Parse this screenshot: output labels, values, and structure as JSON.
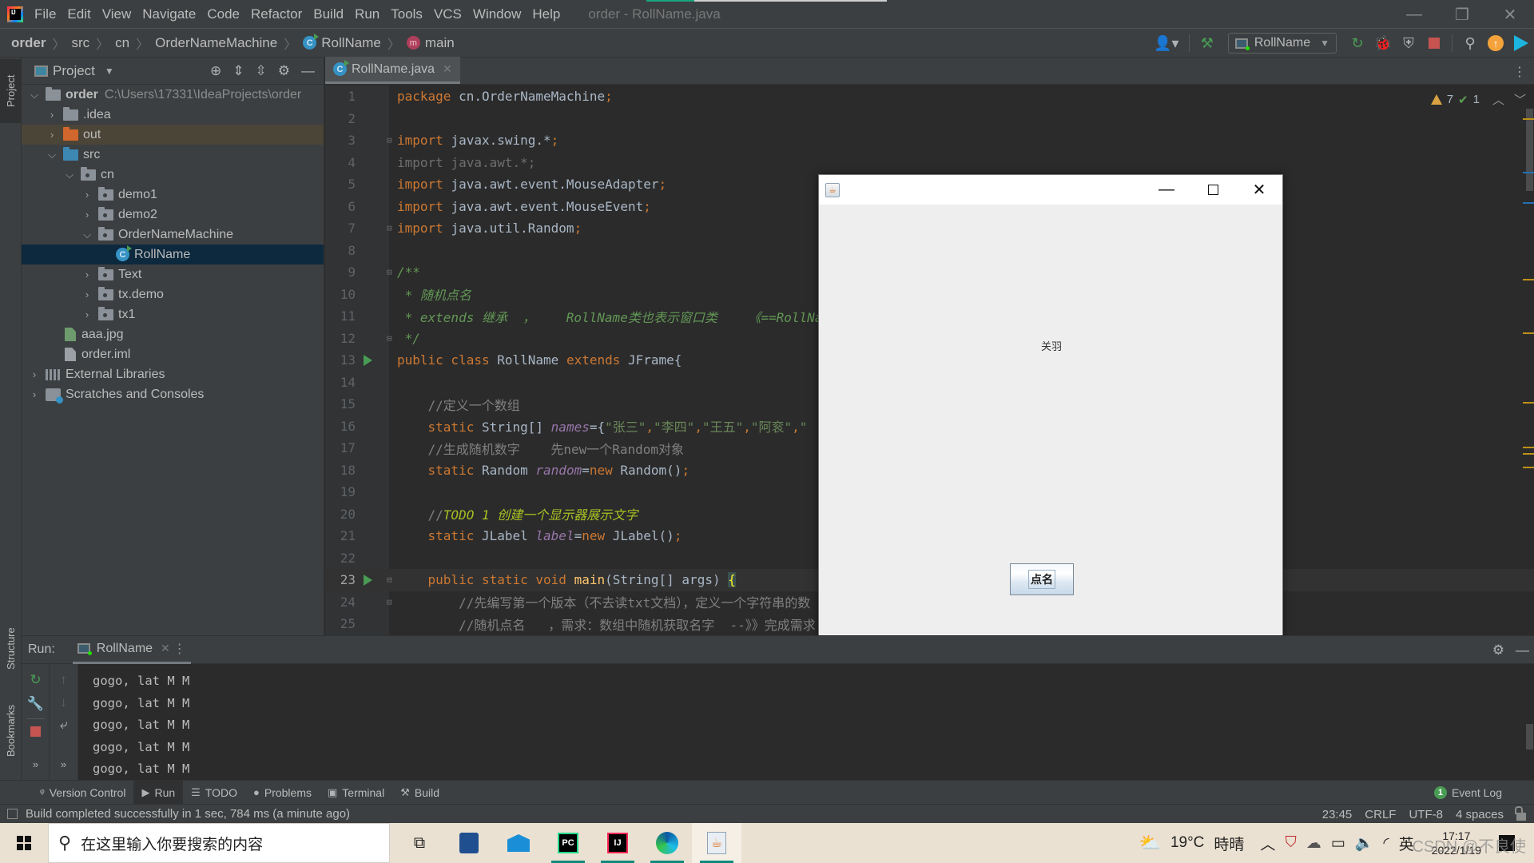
{
  "titlebar": {
    "menu": [
      "File",
      "Edit",
      "View",
      "Navigate",
      "Code",
      "Refactor",
      "Build",
      "Run",
      "Tools",
      "VCS",
      "Window",
      "Help"
    ],
    "window_title": "order - RollName.java",
    "controls": {
      "minimize": "—",
      "restore": "❐",
      "close": "✕"
    }
  },
  "navbar": {
    "breadcrumbs": [
      "order",
      "src",
      "cn",
      "OrderNameMachine",
      "RollName",
      "main"
    ],
    "run_config": "RollName"
  },
  "stripe": {
    "project_tab": "Project",
    "structure_tab": "Structure",
    "bookmarks_tab": "Bookmarks"
  },
  "project": {
    "title": "Project",
    "tree": [
      {
        "label": "order",
        "hint": "C:\\Users\\17331\\IdeaProjects\\order",
        "depth": 0,
        "expanded": true,
        "icon": "module-folder-icon"
      },
      {
        "label": ".idea",
        "depth": 1,
        "expanded": false,
        "icon": "folder-icon"
      },
      {
        "label": "out",
        "depth": 1,
        "expanded": false,
        "icon": "excluded-folder-icon"
      },
      {
        "label": "src",
        "depth": 1,
        "expanded": true,
        "icon": "source-folder-icon"
      },
      {
        "label": "cn",
        "depth": 2,
        "expanded": true,
        "icon": "package-icon"
      },
      {
        "label": "demo1",
        "depth": 3,
        "expanded": false,
        "icon": "package-icon"
      },
      {
        "label": "demo2",
        "depth": 3,
        "expanded": false,
        "icon": "package-icon"
      },
      {
        "label": "OrderNameMachine",
        "depth": 3,
        "expanded": true,
        "icon": "package-icon"
      },
      {
        "label": "RollName",
        "depth": 4,
        "selected": true,
        "icon": "java-class-icon"
      },
      {
        "label": "Text",
        "depth": 3,
        "expanded": false,
        "icon": "package-icon"
      },
      {
        "label": "tx.demo",
        "depth": 3,
        "expanded": false,
        "icon": "package-icon"
      },
      {
        "label": "tx1",
        "depth": 3,
        "expanded": false,
        "icon": "package-icon"
      },
      {
        "label": "aaa.jpg",
        "depth": 1,
        "icon": "image-file-icon"
      },
      {
        "label": "order.iml",
        "depth": 1,
        "icon": "iml-file-icon"
      },
      {
        "label": "External Libraries",
        "depth": 0,
        "expanded": false,
        "icon": "libraries-icon"
      },
      {
        "label": "Scratches and Consoles",
        "depth": 0,
        "expanded": false,
        "icon": "scratches-icon"
      }
    ]
  },
  "editor": {
    "tab": "RollName.java",
    "inspections": {
      "warnings": "7",
      "weak_warnings": "1"
    },
    "current_line": 23,
    "lines": [
      {
        "n": "1",
        "tokens": [
          [
            "kw",
            "package "
          ],
          [
            "",
            "cn.OrderNameMachine"
          ],
          [
            "kw",
            ";"
          ]
        ]
      },
      {
        "n": "2",
        "tokens": []
      },
      {
        "n": "3",
        "fold": true,
        "tokens": [
          [
            "kw",
            "import "
          ],
          [
            "",
            "javax.swing.*"
          ],
          [
            "kw",
            ";"
          ]
        ]
      },
      {
        "n": "4",
        "tokens": [
          [
            "dim",
            "import java.awt.*;"
          ]
        ]
      },
      {
        "n": "5",
        "tokens": [
          [
            "kw",
            "import "
          ],
          [
            "",
            "java.awt.event.MouseAdapter"
          ],
          [
            "kw",
            ";"
          ]
        ]
      },
      {
        "n": "6",
        "tokens": [
          [
            "kw",
            "import "
          ],
          [
            "",
            "java.awt.event.MouseEvent"
          ],
          [
            "kw",
            ";"
          ]
        ]
      },
      {
        "n": "7",
        "fold": true,
        "tokens": [
          [
            "kw",
            "import "
          ],
          [
            "",
            "java.util.Random"
          ],
          [
            "kw",
            ";"
          ]
        ]
      },
      {
        "n": "8",
        "tokens": []
      },
      {
        "n": "9",
        "fold": true,
        "tokens": [
          [
            "doc",
            "/**"
          ]
        ]
      },
      {
        "n": "10",
        "tokens": [
          [
            "doc",
            " * 随机点名"
          ]
        ]
      },
      {
        "n": "11",
        "tokens": [
          [
            "doc",
            " * extends 继承  ，    RollName类也表示窗口类    《==RollNa"
          ]
        ]
      },
      {
        "n": "12",
        "fold": true,
        "tokens": [
          [
            "doc",
            " */"
          ]
        ]
      },
      {
        "n": "13",
        "run": true,
        "tokens": [
          [
            "kw",
            "public class "
          ],
          [
            "",
            "RollName "
          ],
          [
            "kw",
            "extends "
          ],
          [
            "",
            "JFrame{"
          ]
        ]
      },
      {
        "n": "14",
        "tokens": []
      },
      {
        "n": "15",
        "tokens": [
          [
            "cm",
            "    //定义一个数组"
          ]
        ]
      },
      {
        "n": "16",
        "tokens": [
          [
            "kw",
            "    static "
          ],
          [
            "",
            "String[] "
          ],
          [
            "fld",
            "names"
          ],
          [
            "",
            "={"
          ],
          [
            "str",
            "\"张三\""
          ],
          [
            "kw",
            ","
          ],
          [
            "str",
            "\"李四\""
          ],
          [
            "kw",
            ","
          ],
          [
            "str",
            "\"王五\""
          ],
          [
            "kw",
            ","
          ],
          [
            "str",
            "\"阿衮\""
          ],
          [
            "kw",
            ","
          ],
          [
            "str",
            "\""
          ]
        ]
      },
      {
        "n": "17",
        "tokens": [
          [
            "cm",
            "    //生成随机数字    先new一个Random对象"
          ]
        ]
      },
      {
        "n": "18",
        "tokens": [
          [
            "kw",
            "    static "
          ],
          [
            "",
            "Random "
          ],
          [
            "fld",
            "random"
          ],
          [
            "",
            "="
          ],
          [
            "kw",
            "new "
          ],
          [
            "",
            "Random()"
          ],
          [
            "kw",
            ";"
          ]
        ]
      },
      {
        "n": "19",
        "tokens": []
      },
      {
        "n": "20",
        "tokens": [
          [
            "cm",
            "    //"
          ],
          [
            "todo",
            "TODO 1 创建一个显示器展示文字"
          ]
        ]
      },
      {
        "n": "21",
        "tokens": [
          [
            "kw",
            "    static "
          ],
          [
            "",
            "JLabel "
          ],
          [
            "fld",
            "label"
          ],
          [
            "",
            "="
          ],
          [
            "kw",
            "new "
          ],
          [
            "",
            "JLabel()"
          ],
          [
            "kw",
            ";"
          ]
        ]
      },
      {
        "n": "22",
        "tokens": []
      },
      {
        "n": "23",
        "run": true,
        "fold": true,
        "tokens": [
          [
            "kw",
            "    public static void "
          ],
          [
            "fn",
            "main"
          ],
          [
            "",
            "(String[] args) "
          ],
          [
            "brace",
            "{"
          ]
        ]
      },
      {
        "n": "24",
        "fold": true,
        "tokens": [
          [
            "cm",
            "        //先编写第一个版本（不去读txt文档），定义一个字符串的数"
          ]
        ]
      },
      {
        "n": "25",
        "tokens": [
          [
            "cm",
            "        //随机点名   ，需求：数组中随机获取名字  --》》完成需求"
          ]
        ]
      }
    ]
  },
  "swing_app": {
    "name_label": "关羽",
    "button": "点名"
  },
  "run_panel": {
    "label": "Run:",
    "tab": "RollName",
    "console": [
      "gogo, lat M M",
      "gogo, lat M M",
      "gogo, lat M M",
      "gogo, lat M M",
      "gogo, lat M M"
    ]
  },
  "tool_tabs": [
    {
      "label": "Version Control",
      "icon": "ᵠ"
    },
    {
      "label": "Run",
      "icon": "▶",
      "active": true
    },
    {
      "label": "TODO",
      "icon": "☰"
    },
    {
      "label": "Problems",
      "icon": "●"
    },
    {
      "label": "Terminal",
      "icon": "▣"
    },
    {
      "label": "Build",
      "icon": "⚒"
    }
  ],
  "event_log": {
    "count": "1",
    "label": "Event Log"
  },
  "status": {
    "message": "Build completed successfully in 1 sec, 784 ms (a minute ago)",
    "position": "23:45",
    "line_sep": "CRLF",
    "encoding": "UTF-8",
    "indent": "4 spaces"
  },
  "taskbar": {
    "search_placeholder": "在这里输入你要搜索的内容",
    "weather_temp": "19°C",
    "weather_desc": "時晴",
    "ime": "英",
    "time": "17:17",
    "date": "2022/1/19",
    "watermark": "CSDN @不良使"
  },
  "colors": {
    "accent": "#499c54",
    "keyword": "#cc7832",
    "selection": "#0d293e",
    "warning": "#d9a343"
  }
}
